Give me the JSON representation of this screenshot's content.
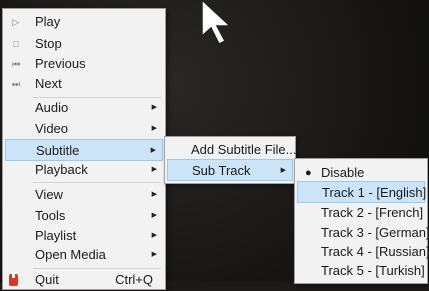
{
  "main_menu": {
    "items": [
      {
        "label": "Play",
        "icon": "play-icon",
        "glyph": "▷"
      },
      {
        "label": "Stop",
        "icon": "stop-icon",
        "glyph": "□"
      },
      {
        "label": "Previous",
        "icon": "previous-icon",
        "glyph": "⏮"
      },
      {
        "label": "Next",
        "icon": "next-icon",
        "glyph": "⏭"
      },
      {
        "label": "Audio"
      },
      {
        "label": "Video"
      },
      {
        "label": "Subtitle"
      },
      {
        "label": "Playback"
      },
      {
        "label": "View"
      },
      {
        "label": "Tools"
      },
      {
        "label": "Playlist"
      },
      {
        "label": "Open Media"
      },
      {
        "label": "Quit",
        "shortcut": "Ctrl+Q",
        "icon": "quit-icon"
      }
    ],
    "highlighted": "Subtitle"
  },
  "subtitle_menu": {
    "items": [
      {
        "label": "Add Subtitle File..."
      },
      {
        "label": "Sub Track"
      }
    ],
    "highlighted": "Sub Track"
  },
  "sub_track_menu": {
    "items": [
      {
        "label": "Disable",
        "selected": true
      },
      {
        "label": "Track 1 - [English]"
      },
      {
        "label": "Track 2 - [French]"
      },
      {
        "label": "Track 3 - [German]"
      },
      {
        "label": "Track 4 - [Russian]"
      },
      {
        "label": "Track 5 - [Turkish]"
      }
    ],
    "highlighted": "Track 1 - [English]"
  },
  "colors": {
    "menu_bg": "#f2f2f2",
    "highlight_bg": "#cce4f7",
    "highlight_border": "#99c9ef",
    "background": "#1b1a18"
  }
}
